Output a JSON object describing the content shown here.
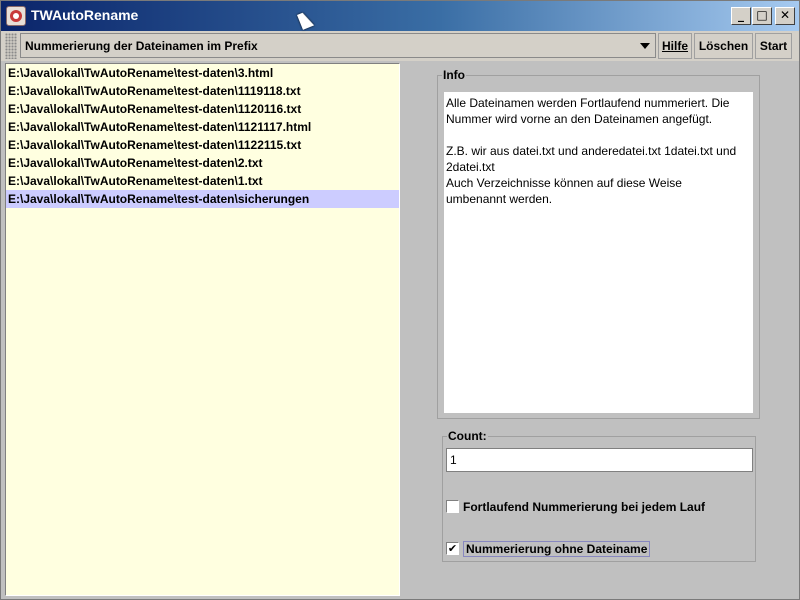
{
  "window": {
    "title": "TWAutoRename"
  },
  "toolbar": {
    "mode_selected": "Nummerierung der Dateinamen im Prefix",
    "help_label": "Hilfe",
    "clear_label": "Löschen",
    "start_label": "Start"
  },
  "files": [
    "E:\\Java\\lokal\\TwAutoRename\\test-daten\\3.html",
    "E:\\Java\\lokal\\TwAutoRename\\test-daten\\1119118.txt",
    "E:\\Java\\lokal\\TwAutoRename\\test-daten\\1120116.txt",
    "E:\\Java\\lokal\\TwAutoRename\\test-daten\\1121117.html",
    "E:\\Java\\lokal\\TwAutoRename\\test-daten\\1122115.txt",
    "E:\\Java\\lokal\\TwAutoRename\\test-daten\\2.txt",
    "E:\\Java\\lokal\\TwAutoRename\\test-daten\\1.txt",
    "E:\\Java\\lokal\\TwAutoRename\\test-daten\\sicherungen"
  ],
  "selected_file_index": 7,
  "info": {
    "title": "Info",
    "lines": [
      "Alle Dateinamen werden Fortlaufend nummeriert. Die",
      "Nummer wird vorne an den Dateinamen angefügt.",
      "",
      "Z.B. wir aus datei.txt und anderedatei.txt 1datei.txt und",
      "2datei.txt",
      "Auch Verzeichnisse können auf diese Weise",
      "umbenannt werden."
    ]
  },
  "count": {
    "title": "Count:",
    "value": "1",
    "option1_label": "Fortlaufend Nummerierung bei jedem Lauf",
    "option1_checked": false,
    "option2_label": "Nummerierung ohne Dateiname",
    "option2_checked": true
  },
  "colors": {
    "list_bg": "#ffffe0",
    "selection": "#ccccff",
    "title_start": "#0a246a",
    "title_end": "#a6caf0"
  }
}
